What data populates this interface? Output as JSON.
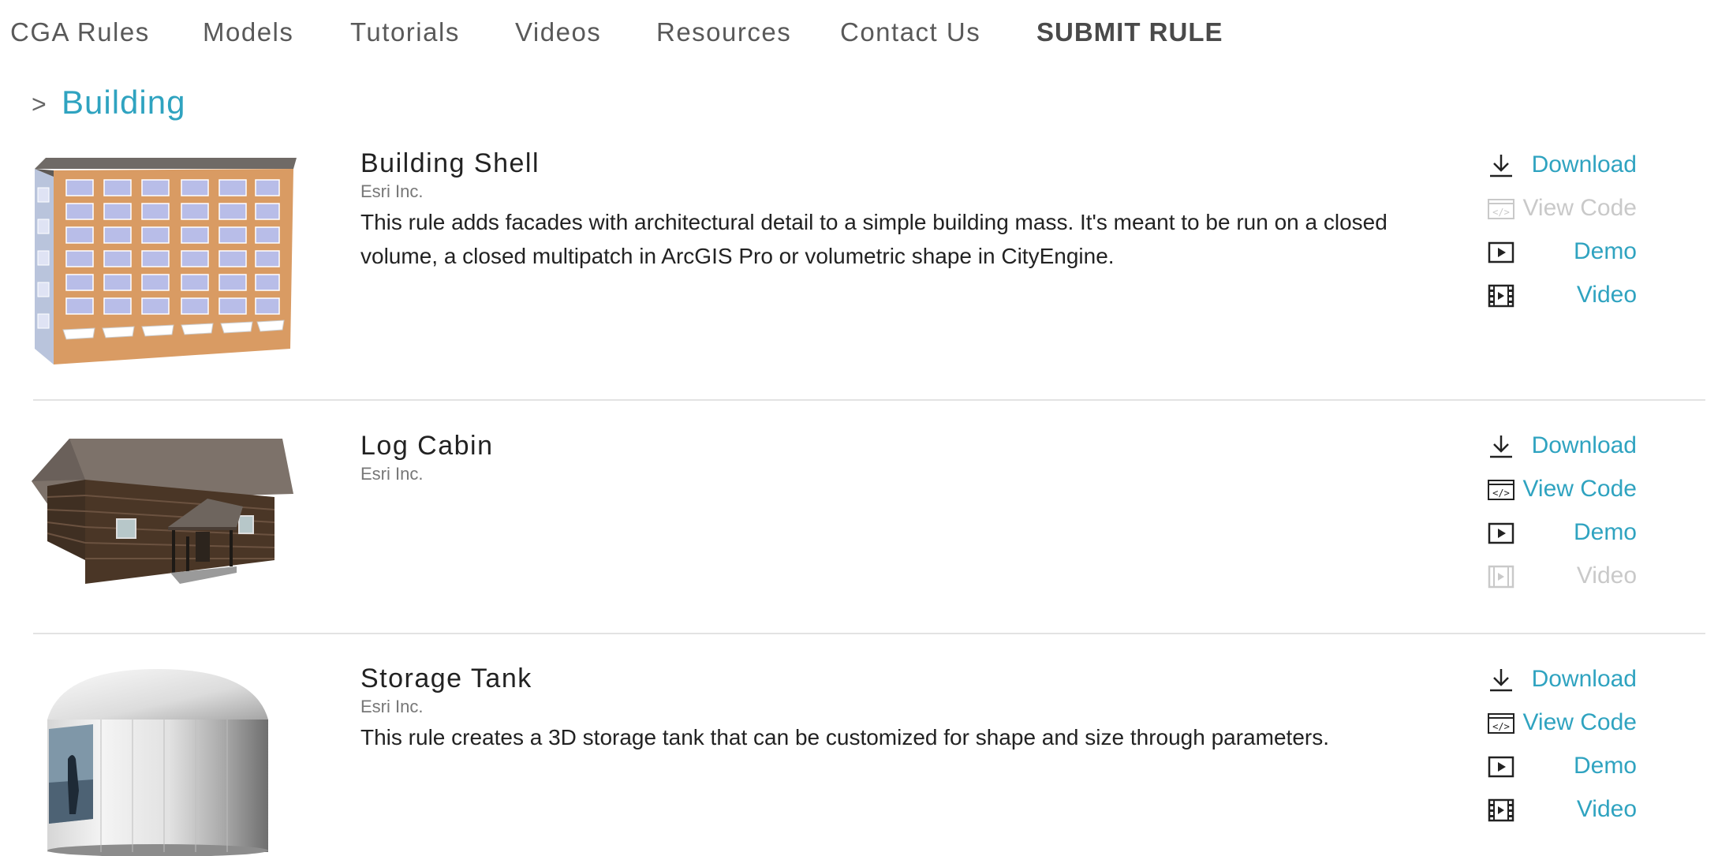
{
  "nav": {
    "items": [
      "CGA Rules",
      "Models",
      "Tutorials",
      "Videos",
      "Resources",
      "Contact Us"
    ],
    "submit_label": "SUBMIT RULE"
  },
  "section": {
    "chevron": ">",
    "title": "Building"
  },
  "rules": [
    {
      "title": "Building Shell",
      "author": "Esri Inc.",
      "description": "This rule adds facades with architectural detail to a simple building mass. It's meant to be run on a closed volume, a closed multipatch in ArcGIS Pro or volumetric shape in CityEngine.",
      "actions": {
        "download": "Download",
        "view_code": "View Code",
        "demo": "Demo",
        "video": "Video"
      },
      "view_code_enabled": false,
      "video_enabled": true
    },
    {
      "title": "Log Cabin",
      "author": "Esri Inc.",
      "description": "",
      "actions": {
        "download": "Download",
        "view_code": "View Code",
        "demo": "Demo",
        "video": "Video"
      },
      "view_code_enabled": true,
      "video_enabled": false
    },
    {
      "title": "Storage Tank",
      "author": "Esri Inc.",
      "description": "This rule creates a 3D storage tank that can be customized for shape and size through parameters.",
      "actions": {
        "download": "Download",
        "view_code": "View Code",
        "demo": "Demo",
        "video": "Video"
      },
      "view_code_enabled": true,
      "video_enabled": true
    }
  ],
  "colors": {
    "accent": "#2fa3c0",
    "disabled": "#c9c9c9",
    "text": "#222222"
  }
}
